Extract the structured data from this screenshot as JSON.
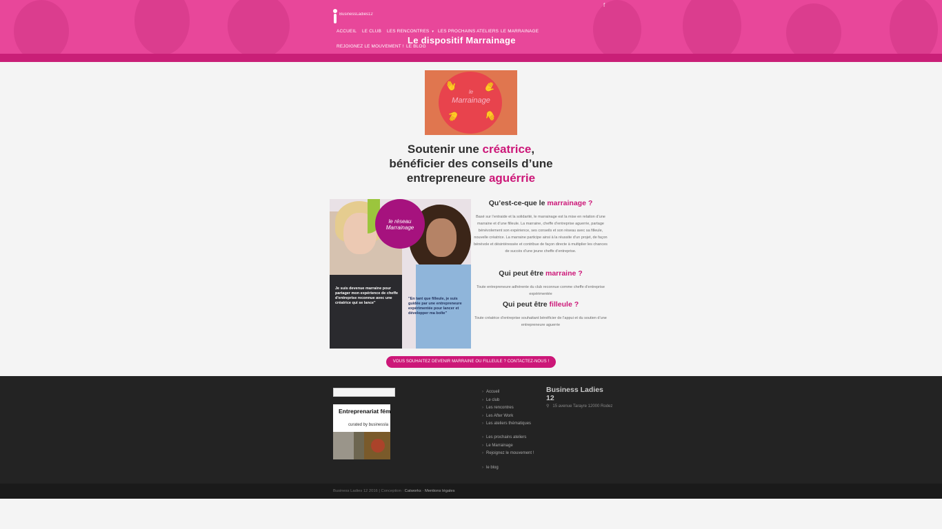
{
  "header": {
    "logo_text": "BusinessLadies12",
    "facebook_icon": "facebook-icon",
    "nav": [
      {
        "label": "Accueil"
      },
      {
        "label": "Le club"
      },
      {
        "label": "Les rencontres"
      },
      {
        "label": "Les prochains ateliers"
      },
      {
        "label": "Le marrainage"
      },
      {
        "label": "Rejoignez le mouvement !"
      },
      {
        "label": "Le blog"
      }
    ],
    "dropdown_icon": "chevron-down-icon",
    "page_title": "Le dispositif Marrainage"
  },
  "main": {
    "marrainage_image": {
      "small": "le",
      "big": "Marrainage"
    },
    "headline": {
      "line1_a": "Soutenir une ",
      "line1_accent": "créatrice",
      "line1_b": ",",
      "line2": "bénéficier des conseils d’une",
      "line3_a": "entrepreneure ",
      "line3_accent": "aguérrie"
    },
    "photo": {
      "logo_text": "le réseau Marrainage",
      "quote_left": "Je suis devenue marraine pour partager mon expérience de cheffe d'entreprise reconnue avec une créatrice qui se lance\"",
      "quote_right": "\"En tant que filleule, je suis guidée par une entrepreneure expérimentée pour lancer et développer ma boîte\""
    },
    "sections": [
      {
        "title_a": "Qu’est-ce-que le ",
        "title_accent": "marrainage ?",
        "text": "Basé sur l’entraide et la solidarité, le marrainage est la mise en relation d’une marraine et d’une filleule. La marraine, cheffe d’entreprise aguerrie, partage bénévolement son expérience, ses conseils et son réseau avec sa filleule, nouvelle créatrice. La marraine participe ainsi à la réussite d’un projet, de façon bénévole et désintéressée et contribue de façon directe à multiplier les chances de succès d’une jeune cheffe d’entreprise."
      },
      {
        "title_a": "Qui peut être ",
        "title_accent": "marraine ?",
        "text": "Toute entrepreneure adhérente du club reconnue comme cheffe d’entreprise expérimentée"
      },
      {
        "title_a": "Qui peut être ",
        "title_accent": "filleule ?",
        "text": "Toute créatrice d’entreprise souhaitant bénéficier de l’appui et du soutien d’une entrepreneure aguerrie"
      }
    ],
    "cta_label": "Vous souhaitez devenir marraine ou filleule ? Contactez-nous !"
  },
  "footer": {
    "search_placeholder": "",
    "widget": {
      "title": "Entreprenariat fém",
      "curated": "curated by businessla"
    },
    "menu": [
      "Accueil",
      "Le club",
      "Les rencontres",
      "Les After Work",
      "Les ateliers thématiques",
      "Les prochains ateliers",
      "Le Marrainage",
      "Rejoignez le mouvement !",
      "le blog"
    ],
    "chevron_icon": "chevron-right-icon",
    "company_title": "Business Ladies 12",
    "pin_icon": "map-pin-icon",
    "address": "15 avenue Tarayre 12000 Rodez",
    "copyright": "Business Ladies 12  2016 | Conception : ",
    "credit": "Catworks",
    "separator": " - ",
    "legal": "Mentions légales"
  },
  "colors": {
    "pink_header": "#e8479a",
    "accent": "#cc1778",
    "footer_bg": "#232323",
    "page_bg": "#f4f4f4"
  }
}
